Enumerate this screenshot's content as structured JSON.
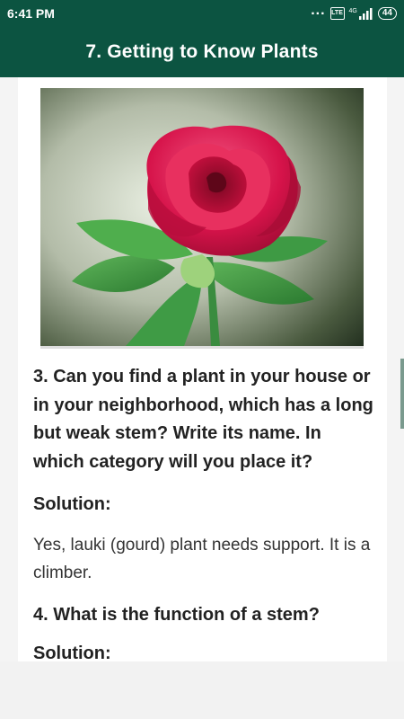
{
  "status_bar": {
    "time": "6:41 PM",
    "dots": "...",
    "volte": "Vo LTE",
    "network": "4G",
    "battery": "44"
  },
  "app_bar": {
    "title": "7. Getting to Know Plants"
  },
  "content": {
    "image_alt": "red rose",
    "q3": "3. Can you find a plant in your house or in your neighborhood, which has a long but weak stem? Write its name. In which category will you place it?",
    "q3_solution_label": "Solution:",
    "q3_answer": "Yes, lauki (gourd) plant needs support. It is a climber.",
    "q4": "4. What is the function of a stem?",
    "q4_solution_label": "Solution:"
  },
  "colors": {
    "app_bar": "#0c5441",
    "rose": "#d6134a"
  }
}
